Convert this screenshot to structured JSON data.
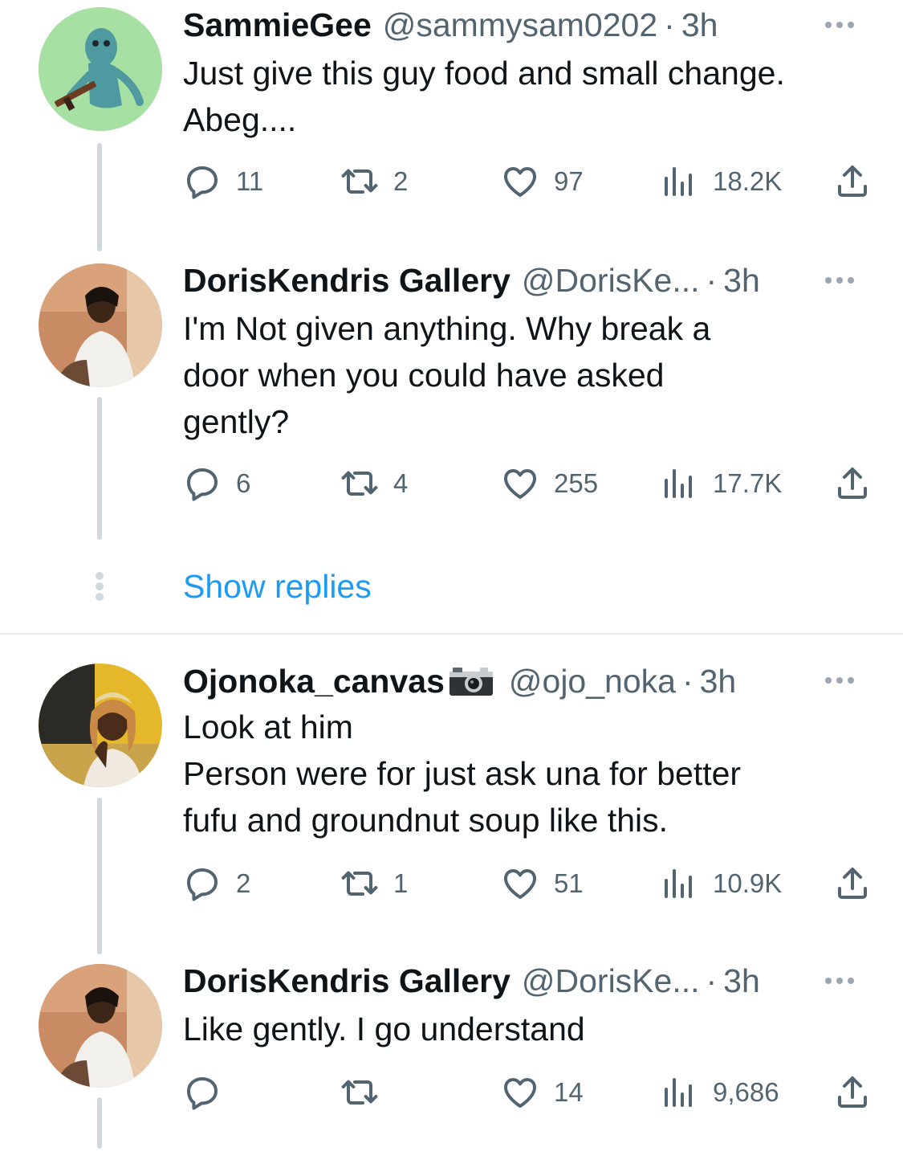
{
  "colors": {
    "text": "#0f1419",
    "secondary": "#536471",
    "link": "#1d9bf0",
    "thread_line": "#cfd9de"
  },
  "icons": {
    "reply": "reply-icon",
    "retweet": "retweet-icon",
    "like": "heart-icon",
    "views": "views-icon",
    "share": "share-icon",
    "more": "more-icon"
  },
  "tweets": [
    {
      "name": "SammieGee",
      "handle": "@sammysam0202",
      "separator": "·",
      "time": "3h",
      "lines": [
        "Just give this guy food and small change.",
        "Abeg...."
      ],
      "replies": "11",
      "retweets": "2",
      "likes": "97",
      "views": "18.2K"
    },
    {
      "name": "DorisKendris Gallery",
      "handle": "@DorisKe...",
      "separator": "·",
      "time": "3h",
      "lines": [
        "I'm Not given anything. Why break a",
        "door when you could have asked",
        "gently?"
      ],
      "replies": "6",
      "retweets": "4",
      "likes": "255",
      "views": "17.7K"
    },
    {
      "name": "Ojonoka_canvas",
      "handle": "@ojo_noka",
      "separator": "·",
      "time": "3h",
      "lines": [
        "Look at him",
        "Person were  for just ask una for better",
        "fufu and groundnut soup like this."
      ],
      "replies": "2",
      "retweets": "1",
      "likes": "51",
      "views": "10.9K"
    },
    {
      "name": "DorisKendris Gallery",
      "handle": "@DorisKe...",
      "separator": "·",
      "time": "3h",
      "lines": [
        "Like gently. I go understand"
      ],
      "replies": "",
      "retweets": "",
      "likes": "14",
      "views": "9,686"
    }
  ],
  "show_replies_label": "Show replies"
}
